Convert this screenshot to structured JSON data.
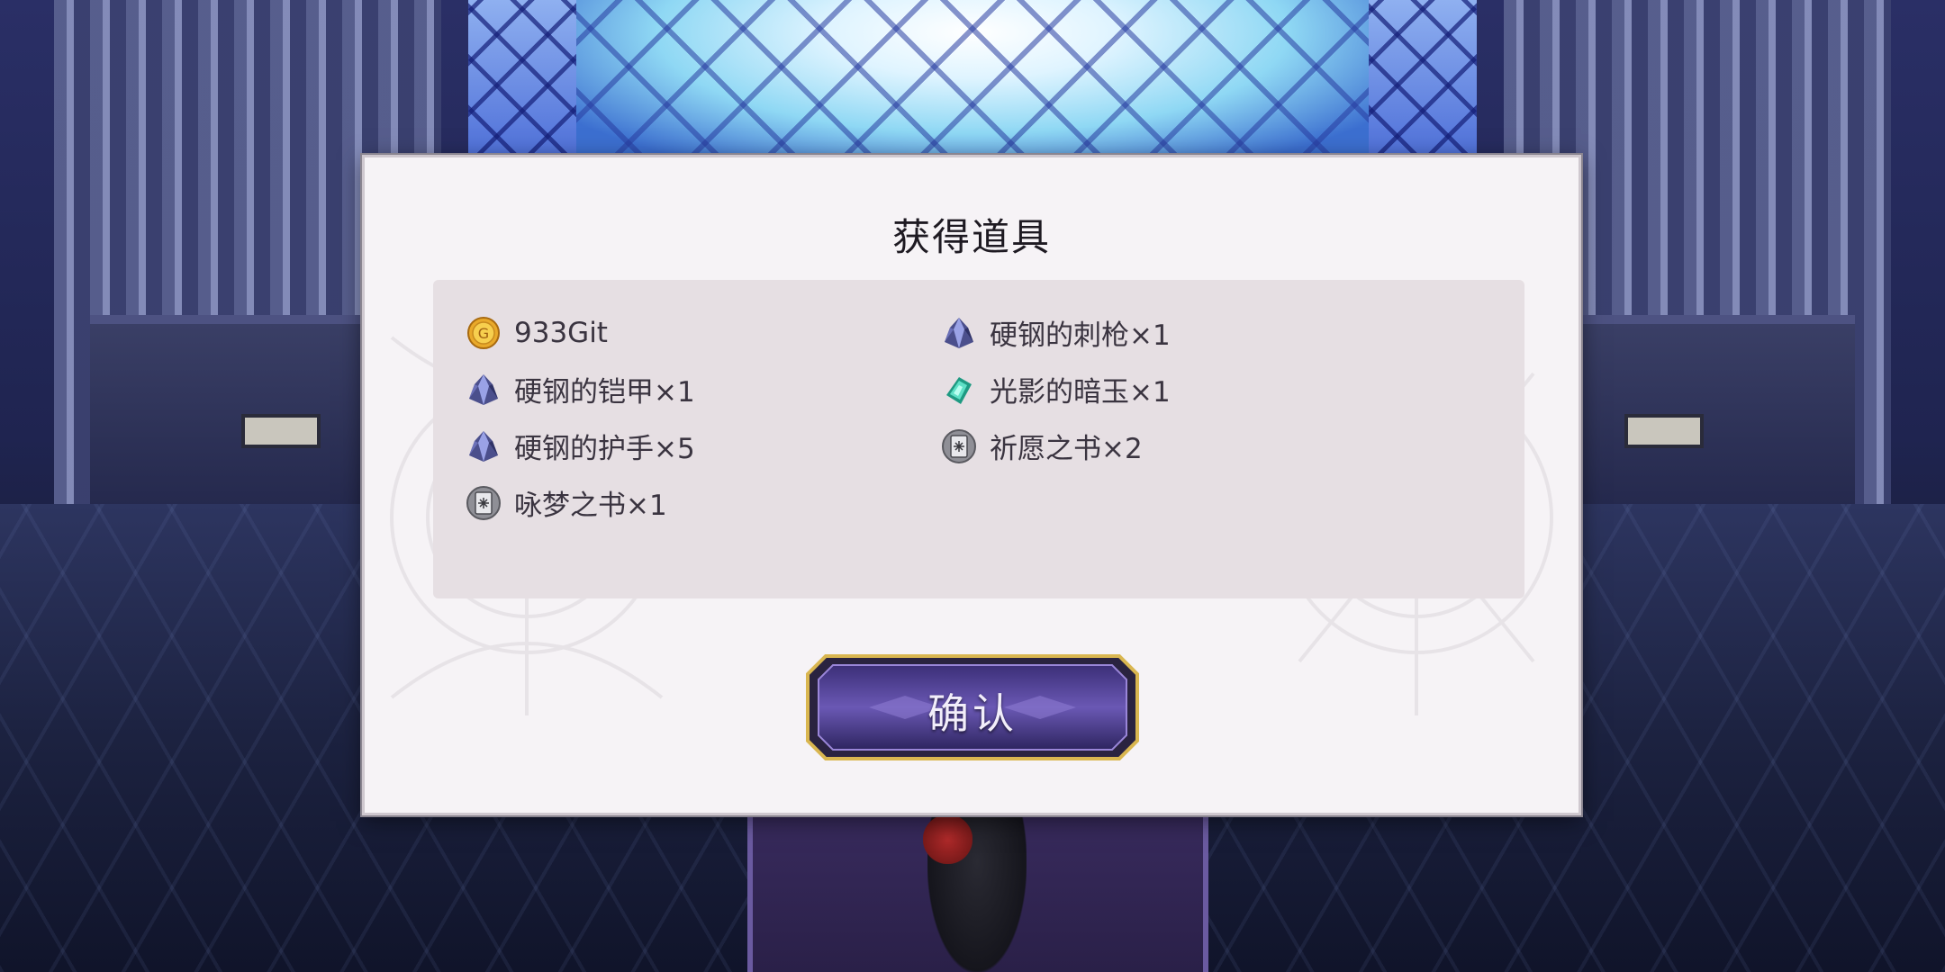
{
  "dialog": {
    "title": "获得道具",
    "confirm_label": "确认"
  },
  "items": [
    {
      "label": "933Git",
      "icon": "gold-coin-icon"
    },
    {
      "label": "硬钢的刺枪×1",
      "icon": "steel-crystal-icon"
    },
    {
      "label": "硬钢的铠甲×1",
      "icon": "steel-crystal-icon"
    },
    {
      "label": "光影的暗玉×1",
      "icon": "green-gem-icon"
    },
    {
      "label": "硬钢的护手×5",
      "icon": "steel-crystal-icon"
    },
    {
      "label": "祈愿之书×2",
      "icon": "book-icon"
    },
    {
      "label": "咏梦之书×1",
      "icon": "book-icon"
    }
  ],
  "colors": {
    "dialog_bg": "#f6f3f6",
    "panel_bg": "#e6dfe3",
    "button_gold": "#d9b650",
    "button_purple": "#5a4aa0"
  }
}
